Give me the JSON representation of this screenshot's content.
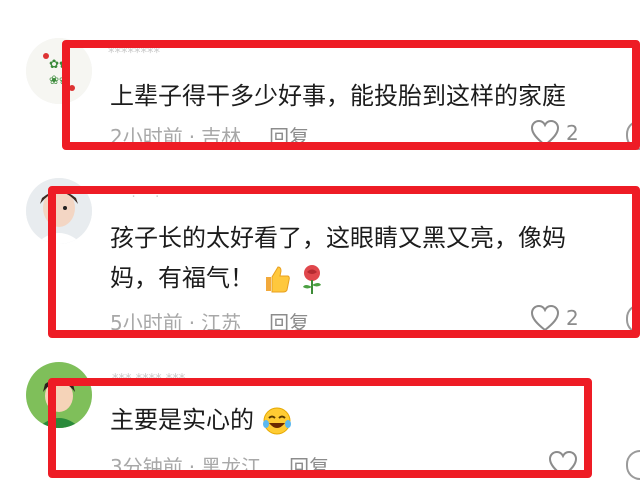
{
  "comments": [
    {
      "username": "********",
      "text": "上辈子得干多少好事，能投胎到这样的家庭",
      "time": "2小时前",
      "location": "吉林",
      "reply": "回复",
      "likes": "2"
    },
    {
      "username": "***.***.*****",
      "line1": "孩子长的太好看了，这眼睛又黑又亮，像妈",
      "line2": "妈，有福气！",
      "time": "5小时前",
      "location": "江苏",
      "reply": "回复",
      "likes": "2"
    },
    {
      "username": "*** **** ***",
      "text": "主要是实心的",
      "time": "3分钟前",
      "location": "黑龙江",
      "reply": "回复",
      "likes": ""
    }
  ],
  "meta_separator": "·",
  "colors": {
    "highlight": "#ee1c25",
    "text": "#1c1c1c",
    "meta": "#a8a8a8"
  }
}
